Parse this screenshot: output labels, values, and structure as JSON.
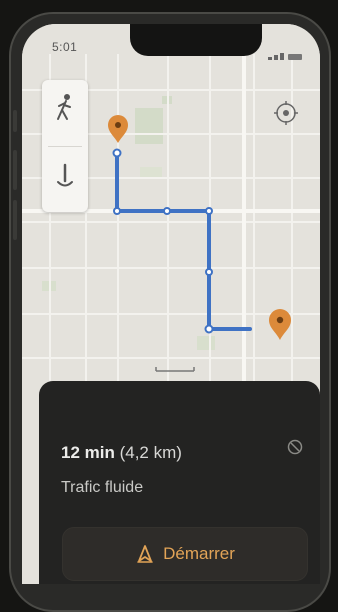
{
  "status_bar": {
    "time": "5:01"
  },
  "route_card": {
    "eta_time": "12 min",
    "eta_distance": "(4,2 km)",
    "traffic_status": "Trafic fluide",
    "start_button_label": "Démarrer"
  },
  "map_controls": [
    "walking-person-icon",
    "route-arrow-icon"
  ],
  "icons": {
    "origin_pin": "origin-pin-icon",
    "destination_pin": "destination-pin-icon",
    "location": "my-location-icon",
    "start": "start-navigation-icon",
    "options": "route-options-icon"
  },
  "colors": {
    "route": "#3f72c4",
    "pin": "#dc8a3a",
    "accent": "#e2a457",
    "card_bg": "#232322",
    "map_bg": "#e4e2dc"
  }
}
